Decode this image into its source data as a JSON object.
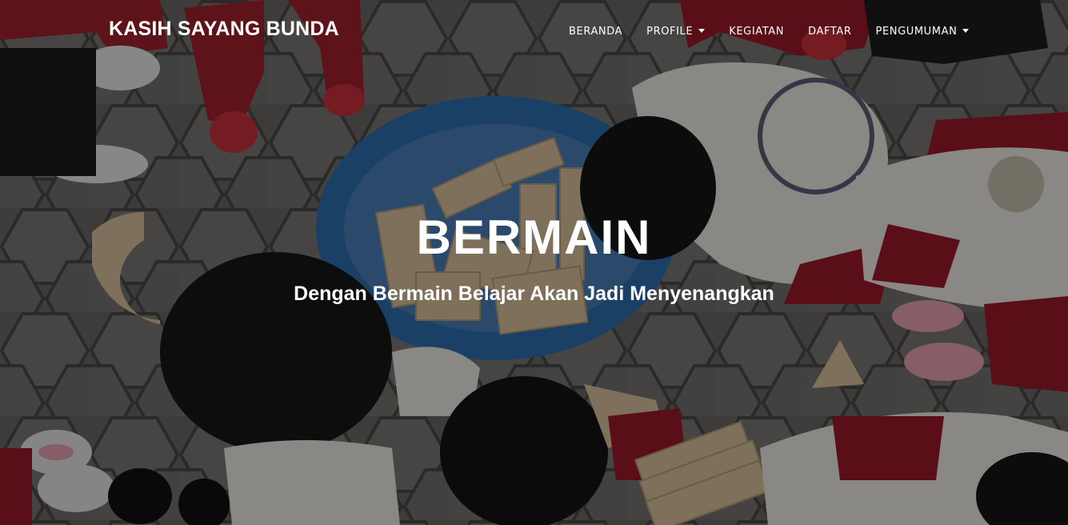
{
  "brand": {
    "name": "KASIH SAYANG BUNDA"
  },
  "nav": {
    "items": [
      {
        "label": "BERANDA",
        "dropdown": false
      },
      {
        "label": "PROFILE",
        "dropdown": true
      },
      {
        "label": "KEGIATAN",
        "dropdown": false
      },
      {
        "label": "DAFTAR",
        "dropdown": false
      },
      {
        "label": "PENGUMUMAN",
        "dropdown": true
      }
    ]
  },
  "hero": {
    "title": "BERMAIN",
    "subtitle": "Dengan Bermain Belajar Akan Jadi Menyenangkan",
    "background": "children-playing-wooden-blocks-photo"
  },
  "colors": {
    "text": "#ffffff",
    "overlay": "#000000",
    "paving": "#5a5857",
    "basket": "#2f6fb0",
    "uniform_red": "#9c1a2a",
    "uniform_white": "#eeeae4",
    "wood": "#d9c29c"
  }
}
